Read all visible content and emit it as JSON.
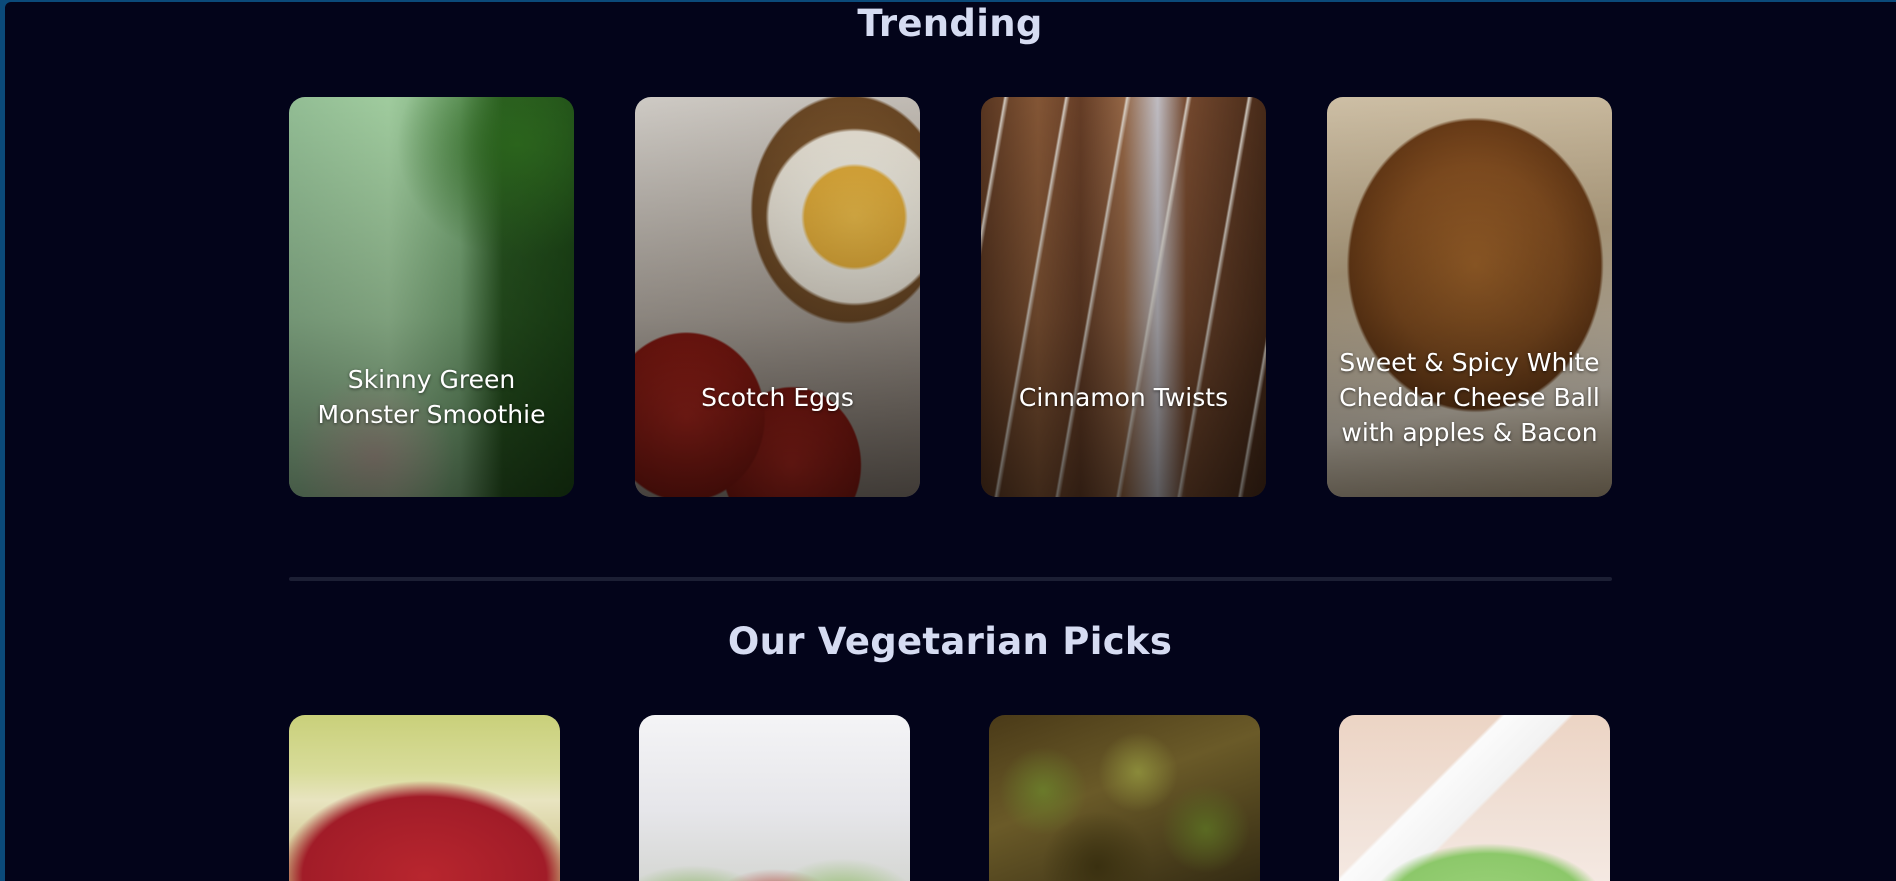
{
  "trending": {
    "title": "Trending",
    "items": [
      {
        "name": "Skinny Green Monster Smoothie"
      },
      {
        "name": "Scotch Eggs"
      },
      {
        "name": "Cinnamon Twists"
      },
      {
        "name": "Sweet & Spicy White Cheddar Cheese Ball with apples & Bacon"
      }
    ]
  },
  "vegetarian": {
    "title": "Our Vegetarian Picks"
  },
  "colors": {
    "background": "#03041a",
    "heading": "#d6dcf2",
    "divider": "#1c1f34"
  }
}
